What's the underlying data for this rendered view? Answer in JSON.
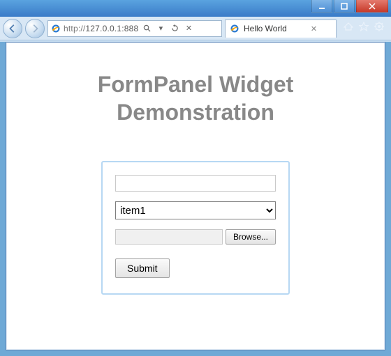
{
  "window": {
    "min_label": "–",
    "max_label": "",
    "close_label": "✕"
  },
  "address_bar": {
    "url_display": "http://127.0.0.1:888"
  },
  "tab": {
    "title": "Hello World"
  },
  "page": {
    "title_line1": "FormPanel Widget",
    "title_line2": "Demonstration"
  },
  "form": {
    "text_value": "",
    "select_value": "item1",
    "browse_label": "Browse...",
    "submit_label": "Submit"
  }
}
